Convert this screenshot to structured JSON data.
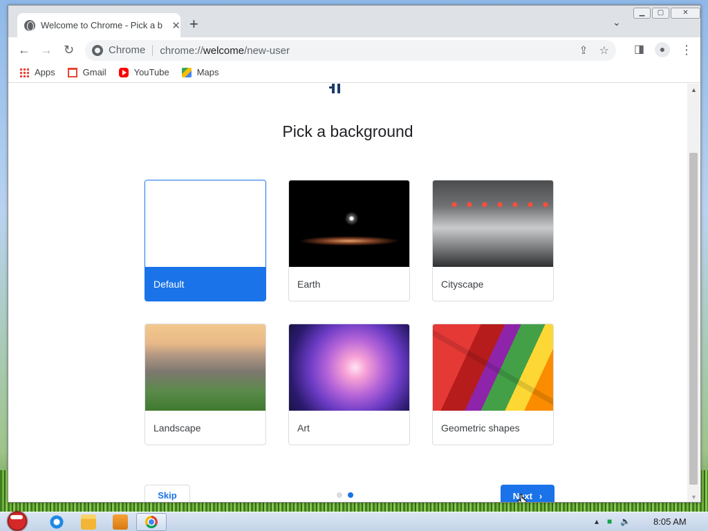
{
  "browser": {
    "tab_title": "Welcome to Chrome - Pick a b",
    "new_tab_symbol": "+",
    "omnibox_chip": "Chrome",
    "url_scheme": "chrome://",
    "url_host": "welcome",
    "url_path": "/new-user"
  },
  "bookmarks": [
    {
      "label": "Apps"
    },
    {
      "label": "Gmail"
    },
    {
      "label": "YouTube"
    },
    {
      "label": "Maps"
    }
  ],
  "page": {
    "heading": "Pick a background",
    "backgrounds": [
      {
        "label": "Default",
        "selected": true
      },
      {
        "label": "Earth",
        "selected": false
      },
      {
        "label": "Cityscape",
        "selected": false
      },
      {
        "label": "Landscape",
        "selected": false
      },
      {
        "label": "Art",
        "selected": false
      },
      {
        "label": "Geometric shapes",
        "selected": false
      }
    ],
    "skip_label": "Skip",
    "next_label": "Next",
    "step_current": 2,
    "step_total": 2
  },
  "taskbar": {
    "clock": "8:05 AM"
  },
  "colors": {
    "accent": "#1a73e8",
    "tabstrip": "#dee1e6"
  }
}
